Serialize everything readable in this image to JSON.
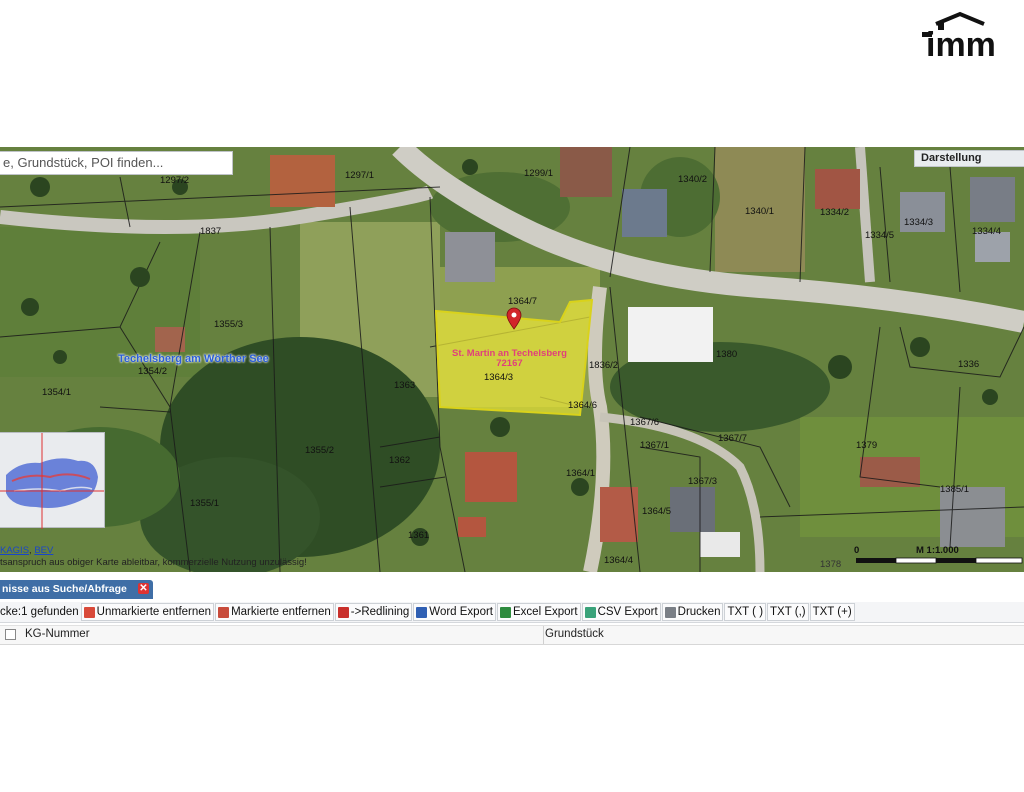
{
  "logo": {
    "text": "imm"
  },
  "search": {
    "placeholder": "e, Grundstück, POI finden..."
  },
  "panel_darstellung": "Darstellung",
  "map": {
    "place_name": "Techelsberg am Wörther See",
    "parcel_marker": {
      "line1": "St. Martin an Techelsberg",
      "line2": "72167"
    },
    "parcel_labels": [
      "1297/2",
      "1297/1",
      "1299/1",
      "1340/2",
      "1340/1",
      "1334/2",
      "1334/3",
      "1334/5",
      "1334/4",
      "1837",
      "1355/3",
      "1354/2",
      "1354/1",
      "1364/7",
      "1363",
      "1364/3",
      "1836/2",
      "1380",
      "1336",
      "1364/6",
      "1367/6",
      "1367/1",
      "1367/7",
      "1379",
      "1355/2",
      "1362",
      "1364/1",
      "1367/3",
      "1385/1",
      "1355/1",
      "1364/5",
      "1361",
      "1364/4",
      "1378"
    ],
    "attribution_links": [
      "KAGIS",
      "BEV"
    ],
    "attribution_text": "tsanspruch aus obiger Karte ableitbar, kommerzielle Nutzung unzulässig!",
    "scale": {
      "zero": "0",
      "label": "M 1:1.000"
    }
  },
  "results_panel": {
    "tab_label": "nisse aus Suche/Abfrage",
    "close": "✕",
    "count_text": "cke:1 gefunden",
    "buttons": [
      {
        "label": "Unmarkierte entfernen",
        "icon": "remove-unmarked-icon",
        "color": "#d94a3a"
      },
      {
        "label": "Markierte entfernen",
        "icon": "remove-marked-icon",
        "color": "#c84b3b"
      },
      {
        "label": "->Redlining",
        "icon": "redlining-icon",
        "color": "#c9302c"
      },
      {
        "label": "Word Export",
        "icon": "word-icon",
        "color": "#2f5fb3"
      },
      {
        "label": "Excel Export",
        "icon": "excel-icon",
        "color": "#2e8b3e"
      },
      {
        "label": "CSV Export",
        "icon": "csv-icon",
        "color": "#3aa27a"
      },
      {
        "label": "Drucken",
        "icon": "print-icon",
        "color": "#7a7f86"
      },
      {
        "label": "TXT ( )",
        "icon": "",
        "color": ""
      },
      {
        "label": "TXT (,)",
        "icon": "",
        "color": ""
      },
      {
        "label": "TXT (+)",
        "icon": "",
        "color": ""
      }
    ],
    "columns": [
      "KG-Nummer",
      "Grundstück"
    ]
  }
}
